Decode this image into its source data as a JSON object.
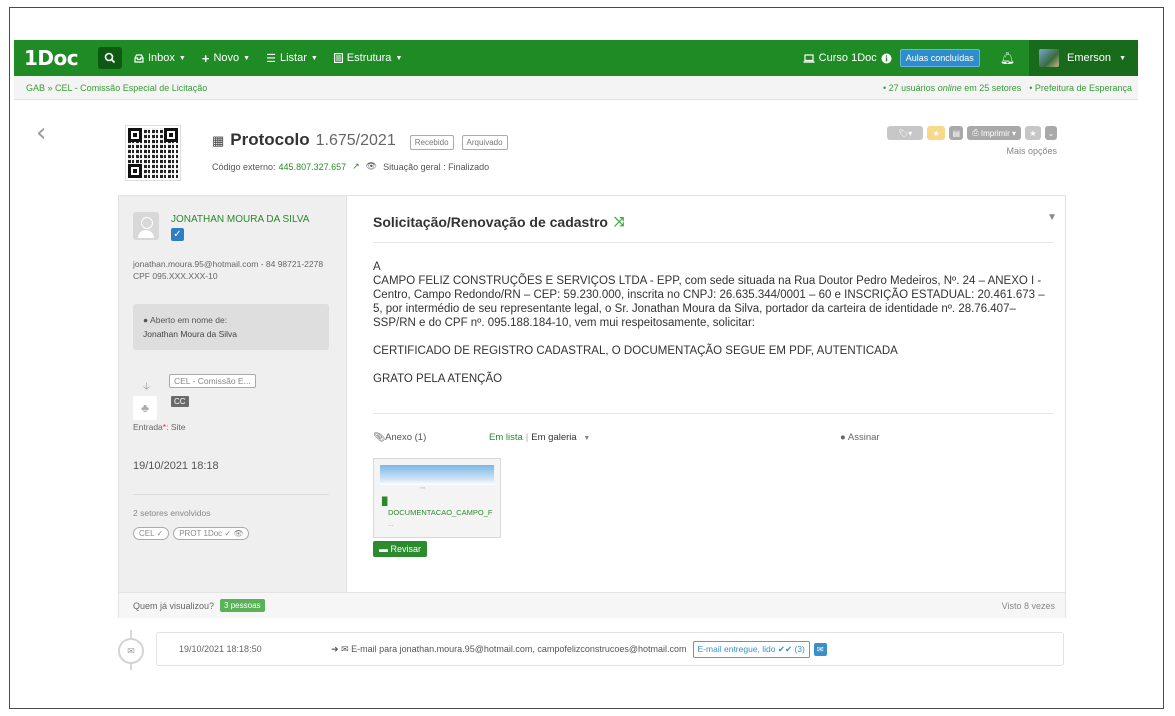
{
  "nav": {
    "logo": "1Doc",
    "search_icon": "search-icon",
    "items": [
      {
        "label": "Inbox",
        "icon": "inbox-icon"
      },
      {
        "label": "Novo",
        "icon": "plus-icon"
      },
      {
        "label": "Listar",
        "icon": "list-icon"
      },
      {
        "label": "Estrutura",
        "icon": "structure-icon"
      }
    ],
    "curso_label": "Curso 1Doc",
    "aulas_badge": "Aulas concluídas",
    "user_name": "Emerson",
    "accent": "#1f8b24"
  },
  "subbar": {
    "breadcrumb": "GAB » CEL - Comissão Especial de Licitação",
    "users_online_prefix": "• 27 usuários",
    "users_online_word": "online",
    "users_online_suffix": "em 25 setores",
    "prefeitura": "• Prefeitura de Esperança"
  },
  "header": {
    "title": "Protocolo",
    "number": "1.675/2021",
    "tags": [
      "Recebido",
      "Arquivado"
    ],
    "external_label": "Código externo:",
    "external_code": "445.807.327.657",
    "situacao": "Situação geral : Finalizado",
    "imprimir": "Imprimir",
    "mais_opcoes": "Mais opções"
  },
  "sender": {
    "name": "JONATHAN MOURA DA SILVA",
    "email_phone": "jonathan.moura.95@hotmail.com - 84 98721-2278",
    "cpf": "CPF 095.XXX.XXX-10",
    "aberto_label": "Aberto em nome de:",
    "aberto_name": "Jonathan Moura da Silva",
    "sector_tag": "CEL - Comissão E...",
    "cc": "CC",
    "entrada_label": "Entrada",
    "entrada_value": ": Site",
    "date": "19/10/2021 18:18",
    "setores_count": "2 setores envolvidos",
    "setores": [
      "CEL ✓",
      "PROT 1Doc ✓ 👁"
    ]
  },
  "message": {
    "subject": "Solicitação/Renovação de cadastro",
    "paragraphs": [
      "A\nCAMPO FELIZ CONSTRUÇÕES E SERVIÇOS LTDA - EPP, com sede situada na Rua Doutor Pedro Medeiros, Nº. 24 – ANEXO I - Centro, Campo Redondo/RN – CEP: 59.230.000, inscrita no CNPJ: 26.635.344/0001 – 60 e INSCRIÇÃO ESTADUAL: 20.461.673 – 5, por intermédio de seu representante legal, o Sr. Jonathan Moura da Silva, portador da carteira de identidade nº. 28.76.407– SSP/RN e do CPF nº. 095.188.184-10, vem mui respeitosamente, solicitar:",
      "CERTIFICADO DE REGISTRO CADASTRAL, O DOCUMENTAÇÃO SEGUE EM PDF, AUTENTICADA",
      "GRATO PELA ATENÇÃO"
    ],
    "anexo_label": "Anexo (1)",
    "em_lista": "Em lista",
    "em_galeria": "Em galeria",
    "assinar": "Assinar",
    "attachment_name": "DOCUMENTACAO_CAMPO_F",
    "attachment_more": "...",
    "revisar": "Revisar"
  },
  "footer": {
    "quem_viu": "Quem já visualizou?",
    "pessoas": "3 pessoas",
    "visto": "Visto 8 vezes"
  },
  "timeline": {
    "date": "19/10/2021 18:18:50",
    "desc": "E-mail para jonathan.moura.95@hotmail.com, campofelizconstrucoes@hotmail.com",
    "badge": "E-mail entregue, lido ✔✔ (3)"
  }
}
